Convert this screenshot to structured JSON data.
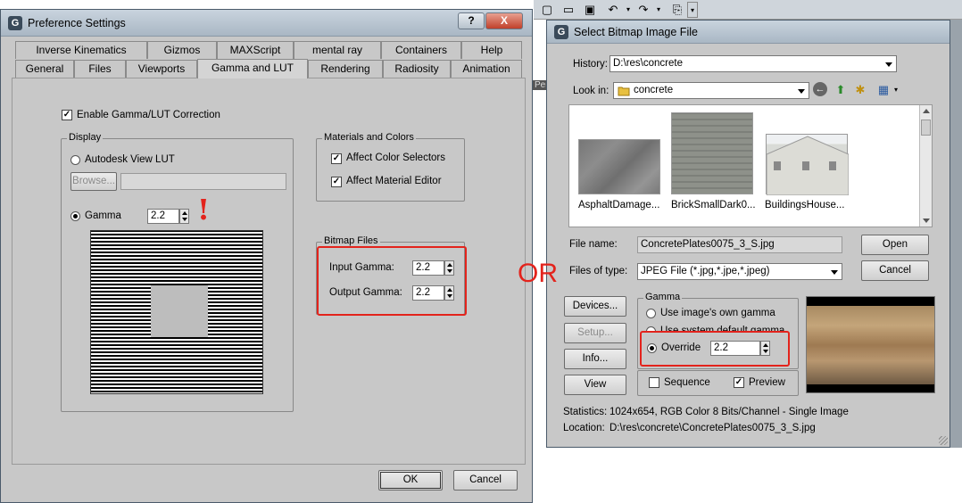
{
  "pref": {
    "title": "Preference Settings",
    "help_glyph": "?",
    "close_glyph": "X",
    "tabs_row1": [
      "Inverse Kinematics",
      "Gizmos",
      "MAXScript",
      "mental ray",
      "Containers",
      "Help"
    ],
    "tabs_row2": [
      "General",
      "Files",
      "Viewports",
      "Gamma and LUT",
      "Rendering",
      "Radiosity",
      "Animation"
    ],
    "enable_label": "Enable Gamma/LUT Correction",
    "display": {
      "group": "Display",
      "autodesk_label": "Autodesk View LUT",
      "browse_label": "Browse...",
      "gamma_label": "Gamma",
      "gamma_value": "2.2"
    },
    "materials": {
      "group": "Materials and Colors",
      "affect_color": "Affect Color Selectors",
      "affect_material": "Affect Material Editor"
    },
    "bitmap": {
      "group": "Bitmap Files",
      "input_label": "Input Gamma:",
      "input_value": "2.2",
      "output_label": "Output Gamma:",
      "output_value": "2.2"
    },
    "ok_label": "OK",
    "cancel_label": "Cancel"
  },
  "annotation": {
    "exclaim": "!",
    "or_text": "OR",
    "color": "#e3231c"
  },
  "bitmap_dialog": {
    "title": "Select Bitmap Image File",
    "history_label": "History:",
    "history_value": "D:\\res\\concrete",
    "lookin_label": "Look in:",
    "lookin_value": "concrete",
    "thumbnails": [
      "AsphaltDamage...",
      "BrickSmallDark0...",
      "BuildingsHouse..."
    ],
    "filename_label": "File name:",
    "filename_value": "ConcretePlates0075_3_S.jpg",
    "filetype_label": "Files of type:",
    "filetype_value": "JPEG File (*.jpg,*.jpe,*.jpeg)",
    "open_label": "Open",
    "cancel_label": "Cancel",
    "devices_label": "Devices...",
    "setup_label": "Setup...",
    "info_label": "Info...",
    "view_label": "View",
    "gamma_group": "Gamma",
    "use_own_label": "Use image's own gamma",
    "use_system_label": "Use system default gamma",
    "override_label": "Override",
    "override_value": "2.2",
    "sequence_label": "Sequence",
    "preview_label": "Preview",
    "statistics_label": "Statistics:",
    "statistics_value": "1024x654, RGB Color 8 Bits/Channel - Single Image",
    "location_label": "Location:",
    "location_value": "D:\\res\\concrete\\ConcretePlates0075_3_S.jpg"
  },
  "background_fragment": "Pers"
}
